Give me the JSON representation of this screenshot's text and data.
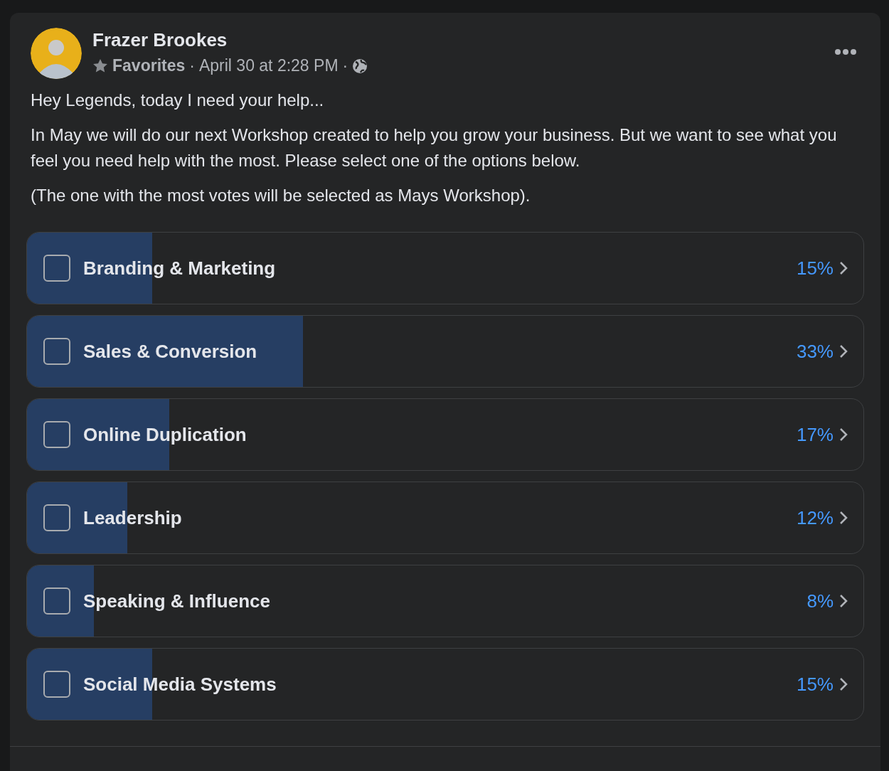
{
  "post": {
    "author": "Frazer Brookes",
    "audience_label": "Favorites",
    "separator_1": "·",
    "timestamp": "April 30 at 2:28 PM",
    "separator_2": "·",
    "paragraphs": [
      "Hey Legends, today I need your help...",
      "In May we will do our next Workshop created to help you grow your business. But we want to see what you feel you need help with the most. Please select one of the options below.",
      "(The one with the most votes will be selected as Mays Workshop)."
    ]
  },
  "poll": {
    "options": [
      {
        "label": "Branding & Marketing",
        "checked": false,
        "level": 0.15,
        "percent": "15%"
      },
      {
        "label": "Sales & Conversion",
        "checked": false,
        "level": 0.33,
        "percent": "33%"
      },
      {
        "label": "Online Duplication",
        "checked": false,
        "level": 0.17,
        "percent": "17%"
      },
      {
        "label": "Leadership",
        "checked": false,
        "level": 0.12,
        "percent": "12%"
      },
      {
        "label": "Speaking & Influence",
        "checked": false,
        "level": 0.08,
        "percent": "8%"
      },
      {
        "label": "Social Media Systems",
        "checked": false,
        "level": 0.15,
        "percent": "15%"
      }
    ]
  }
}
